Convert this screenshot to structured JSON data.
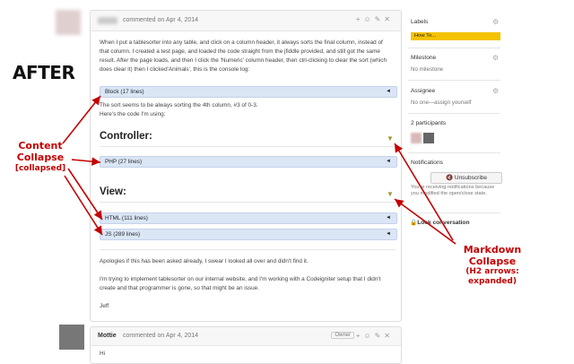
{
  "annotation": {
    "after": "AFTER",
    "content_lines": [
      "Content",
      "Collapse",
      "[collapsed]"
    ],
    "markdown_lines": [
      "Markdown",
      "Collapse",
      "(H2 arrows:",
      "expanded)"
    ]
  },
  "comment": {
    "meta": "commented on Apr 4, 2014",
    "paragraph1": "When I put a tablesorter into any table, and click on a column header, it always sorts the final column, instead of that column. I created a test page, and loaded the code straight from the jfiddle provided, and still got the same result. After the page loads, and then I click the 'Numeric' column header, then ctrl-clicking to clear the sort (which does clear it) then I clicked'Animals', this is the console log:",
    "block1": "Block (17 lines)",
    "paragraph2a": "The sort seems to be always sorting the 4th column, #3 of 0-3.",
    "paragraph2b": "Here's the code I'm using:",
    "h2_controller": "Controller:",
    "block2": "PHP (27 lines)",
    "h2_view": "View:",
    "block3": "HTML (111 lines)",
    "block4": "JS (289 lines)",
    "paragraph3": "Apologies if this has been asked already, I swear I looked all over and didn't find it.",
    "paragraph4": "I'm trying to implement tablesorter on our internal website, and I'm working with a Codeigniter setup that I didn't create and that programmer is gone, so that might be an issue.",
    "signature": "Jeff",
    "collapse_arrow": "◄",
    "h2_arrow": "▼"
  },
  "comment2": {
    "author": "Mottie",
    "meta": "commented on Apr 4, 2014",
    "badge": "Owner",
    "text": "Hi"
  },
  "sidebar": {
    "labels_title": "Labels",
    "label_value": "How To...",
    "milestone_title": "Milestone",
    "milestone_value": "No milestone",
    "assignee_title": "Assignee",
    "assignee_value": "No one—assign yourself",
    "participants_title": "2 participants",
    "notifications_title": "Notifications",
    "unsubscribe_label": "Unsubscribe",
    "notification_note": "You're receiving notifications because you modified the open/close state.",
    "lock_label": "Lock conversation",
    "label_color": "#f4c200"
  },
  "icons": [
    "gear-icon",
    "eye-icon",
    "lock-icon",
    "emoji-icon",
    "pencil-icon",
    "close-icon"
  ]
}
